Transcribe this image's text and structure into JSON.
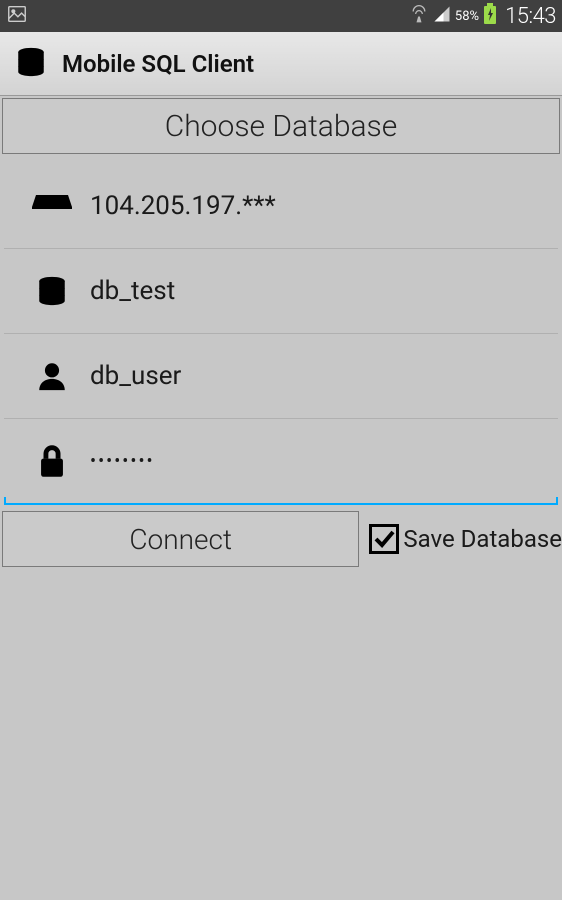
{
  "statusbar": {
    "battery_pct": "58%",
    "time": "15:43"
  },
  "appbar": {
    "title": "Mobile SQL Client"
  },
  "choose_button": "Choose Database",
  "fields": {
    "server": "104.205.197.***",
    "database": "db_test",
    "user": "db_user",
    "password": "••••••••"
  },
  "actions": {
    "connect": "Connect",
    "save_label": "Save Database"
  }
}
